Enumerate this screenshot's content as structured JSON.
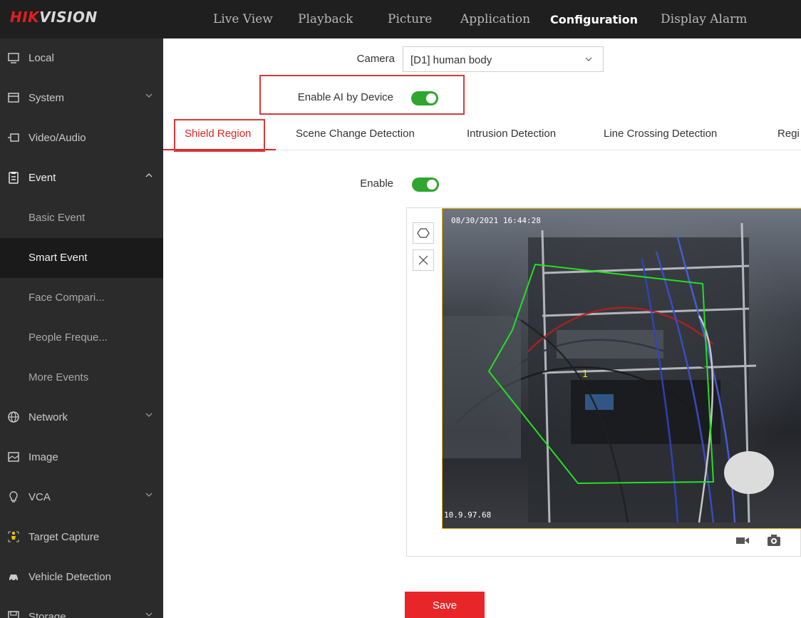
{
  "header": {
    "logo_hik": "HIK",
    "logo_vision": "VISION",
    "nav": [
      "Live View",
      "Playback",
      "Picture",
      "Application",
      "Configuration",
      "Display Alarm"
    ],
    "active_nav": "Configuration"
  },
  "sidebar": {
    "items": [
      {
        "label": "Local",
        "icon": "monitor-icon"
      },
      {
        "label": "System",
        "icon": "system-icon"
      },
      {
        "label": "Video/Audio",
        "icon": "video-audio-icon"
      },
      {
        "label": "Event",
        "icon": "event-icon"
      },
      {
        "label": "Basic Event"
      },
      {
        "label": "Smart Event",
        "selected": true
      },
      {
        "label": "Face Compari..."
      },
      {
        "label": "People Freque..."
      },
      {
        "label": "More Events"
      },
      {
        "label": "Network",
        "icon": "globe-icon"
      },
      {
        "label": "Image",
        "icon": "image-icon"
      },
      {
        "label": "VCA",
        "icon": "bulb-icon"
      },
      {
        "label": "Target Capture",
        "icon": "person-icon"
      },
      {
        "label": "Vehicle Detection",
        "icon": "car-icon"
      },
      {
        "label": "Storage",
        "icon": "storage-icon"
      }
    ]
  },
  "main": {
    "camera_label": "Camera",
    "camera_value": "[D1] human body",
    "ai_label": "Enable AI by Device",
    "ai_enabled": true,
    "tabs": [
      "Shield Region",
      "Scene Change Detection",
      "Intrusion Detection",
      "Line Crossing Detection",
      "Regi"
    ],
    "active_tab": "Shield Region",
    "enable_label": "Enable",
    "enable_enabled": true,
    "video": {
      "osd_time": "08/30/2021 16:44:28",
      "osd_ip": "10.9.97.68",
      "region_number": "1"
    },
    "save_label": "Save"
  },
  "colors": {
    "accent_red": "#e02222",
    "toggle_green": "#2fa62f",
    "sidebar_bg": "#2b2b2b",
    "header_bg": "#1f1f1f",
    "region_green": "#22e022"
  }
}
